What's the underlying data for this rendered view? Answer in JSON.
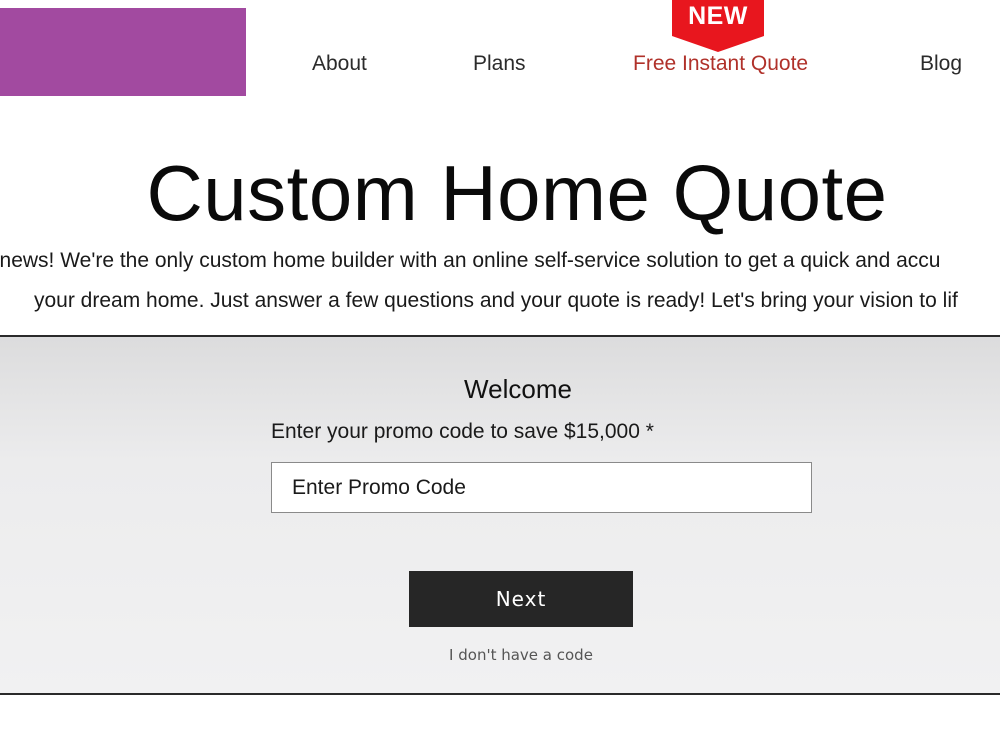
{
  "header": {
    "logo_color": "#a24aa0",
    "nav": {
      "about": "About",
      "plans": "Plans",
      "quote": "Free Instant Quote",
      "blog": "Blog"
    },
    "badge": {
      "text": "NEW",
      "color": "#e8161e"
    },
    "quote_link_color": "#b0312a"
  },
  "hero": {
    "title": "Custom Home Quote",
    "intro_line_1": "g news! We're the only custom home builder with an online self-service solution to get a quick and accu",
    "intro_line_2": "your dream home. Just answer a few questions and your quote is ready! Let's bring your vision to lif"
  },
  "form": {
    "heading": "Welcome",
    "promo_label": "Enter your promo code to save $15,000 *",
    "promo_placeholder": "Enter Promo Code",
    "promo_value": "",
    "next_label": "Next",
    "no_code_label": "I don't have a code"
  }
}
